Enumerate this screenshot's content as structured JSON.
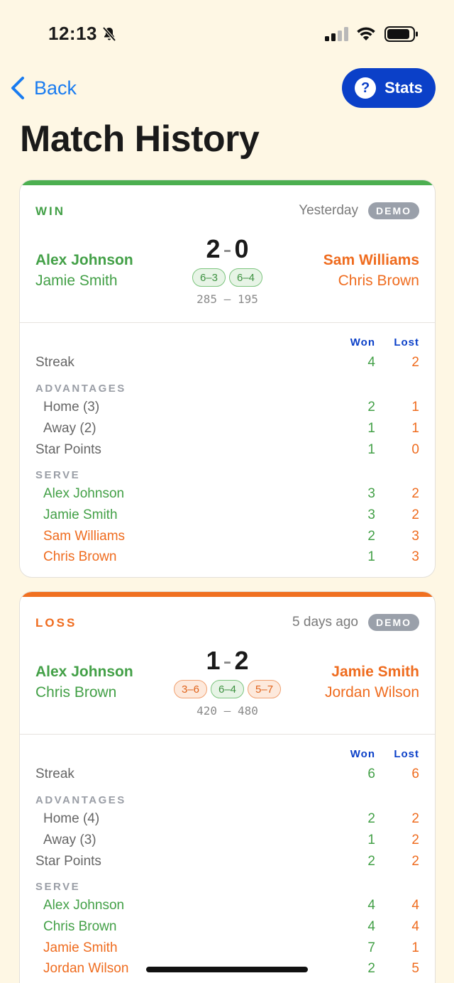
{
  "status_bar": {
    "time": "12:13"
  },
  "nav": {
    "back_label": "Back",
    "stats_label": "Stats",
    "stats_icon": "?"
  },
  "page_title": "Match History",
  "columns": {
    "won": "Won",
    "lost": "Lost"
  },
  "sections": {
    "advantages": "ADVANTAGES",
    "serve": "SERVE"
  },
  "labels": {
    "streak": "Streak",
    "star_points": "Star Points",
    "demo": "DEMO",
    "points_sep": "—"
  },
  "colors": {
    "win": "#43a047",
    "loss": "#ef6c1f",
    "accent": "#0b40c8",
    "background": "#fef7e4"
  },
  "matches": [
    {
      "result": "WIN",
      "date": "Yesterday",
      "team_left": [
        "Alex Johnson",
        "Jamie Smith"
      ],
      "team_right": [
        "Sam Williams",
        "Chris Brown"
      ],
      "score_left": "2",
      "score_right": "0",
      "sets": [
        {
          "score": "6–3",
          "outcome": "won"
        },
        {
          "score": "6–4",
          "outcome": "won"
        }
      ],
      "points_left": "285",
      "points_right": "195",
      "streak": {
        "won": "4",
        "lost": "2"
      },
      "advantages": [
        {
          "label": "Home (3)",
          "won": "2",
          "lost": "1"
        },
        {
          "label": "Away (2)",
          "won": "1",
          "lost": "1"
        }
      ],
      "star_points": {
        "won": "1",
        "lost": "0"
      },
      "serve": [
        {
          "name": "Alex Johnson",
          "team": "left",
          "won": "3",
          "lost": "2"
        },
        {
          "name": "Jamie Smith",
          "team": "left",
          "won": "3",
          "lost": "2"
        },
        {
          "name": "Sam Williams",
          "team": "right",
          "won": "2",
          "lost": "3"
        },
        {
          "name": "Chris Brown",
          "team": "right",
          "won": "1",
          "lost": "3"
        }
      ]
    },
    {
      "result": "LOSS",
      "date": "5 days ago",
      "team_left": [
        "Alex Johnson",
        "Chris Brown"
      ],
      "team_right": [
        "Jamie Smith",
        "Jordan Wilson"
      ],
      "score_left": "1",
      "score_right": "2",
      "sets": [
        {
          "score": "3–6",
          "outcome": "lost"
        },
        {
          "score": "6–4",
          "outcome": "won"
        },
        {
          "score": "5–7",
          "outcome": "lost"
        }
      ],
      "points_left": "420",
      "points_right": "480",
      "streak": {
        "won": "6",
        "lost": "6"
      },
      "advantages": [
        {
          "label": "Home (4)",
          "won": "2",
          "lost": "2"
        },
        {
          "label": "Away (3)",
          "won": "1",
          "lost": "2"
        }
      ],
      "star_points": {
        "won": "2",
        "lost": "2"
      },
      "serve": [
        {
          "name": "Alex Johnson",
          "team": "left",
          "won": "4",
          "lost": "4"
        },
        {
          "name": "Chris Brown",
          "team": "left",
          "won": "4",
          "lost": "4"
        },
        {
          "name": "Jamie Smith",
          "team": "right",
          "won": "7",
          "lost": "1"
        },
        {
          "name": "Jordan Wilson",
          "team": "right",
          "won": "2",
          "lost": "5"
        }
      ]
    }
  ]
}
